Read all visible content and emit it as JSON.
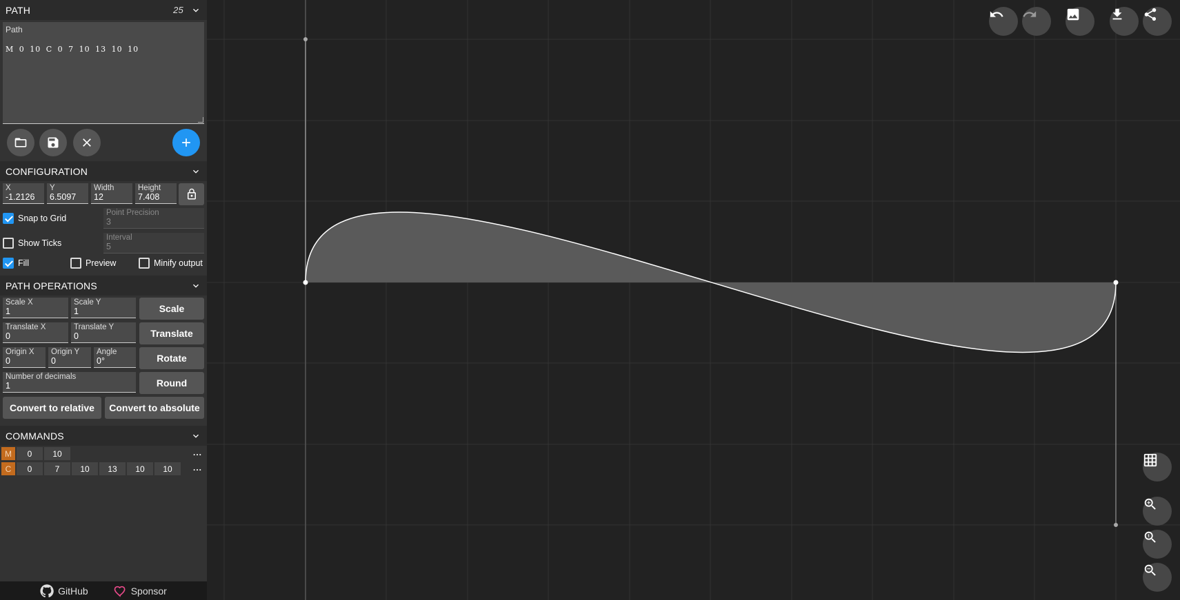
{
  "path_panel": {
    "header": "PATH",
    "count": "25",
    "textarea_label": "Path",
    "textarea_value": "M 0 10 C 0 7 10 13 10 10"
  },
  "configuration": {
    "header": "CONFIGURATION",
    "x_label": "X",
    "x_value": "-1.2126",
    "y_label": "Y",
    "y_value": "6.5097",
    "width_label": "Width",
    "width_value": "12",
    "height_label": "Height",
    "height_value": "7.408",
    "snap_label": "Snap to Grid",
    "snap_checked": true,
    "precision_label": "Point Precision",
    "precision_value": "3",
    "ticks_label": "Show Ticks",
    "ticks_checked": false,
    "interval_label": "Interval",
    "interval_value": "5",
    "fill_label": "Fill",
    "fill_checked": true,
    "preview_label": "Preview",
    "preview_checked": false,
    "minify_label": "Minify output",
    "minify_checked": false
  },
  "operations": {
    "header": "PATH OPERATIONS",
    "scale_x_label": "Scale X",
    "scale_x_value": "1",
    "scale_y_label": "Scale Y",
    "scale_y_value": "1",
    "scale_button": "Scale",
    "translate_x_label": "Translate X",
    "translate_x_value": "0",
    "translate_y_label": "Translate Y",
    "translate_y_value": "0",
    "translate_button": "Translate",
    "origin_x_label": "Origin X",
    "origin_x_value": "0",
    "origin_y_label": "Origin Y",
    "origin_y_value": "0",
    "angle_label": "Angle",
    "angle_value": "0°",
    "rotate_button": "Rotate",
    "decimals_label": "Number of decimals",
    "decimals_value": "1",
    "round_button": "Round",
    "relative_button": "Convert to relative",
    "absolute_button": "Convert to absolute"
  },
  "commands": {
    "header": "COMMANDS",
    "rows": [
      {
        "letter": "M",
        "values": [
          "0",
          "10"
        ]
      },
      {
        "letter": "C",
        "values": [
          "0",
          "7",
          "10",
          "13",
          "10",
          "10"
        ]
      }
    ],
    "more": "..."
  },
  "footer": {
    "github": "GitHub",
    "sponsor": "Sponsor"
  },
  "icons": {
    "open": "folder-icon",
    "save": "save-icon",
    "clear": "close-icon",
    "add": "plus-icon",
    "lock": "lock-open-icon",
    "undo": "undo-icon",
    "redo": "redo-icon",
    "image": "image-icon",
    "download": "download-icon",
    "share": "share-icon",
    "grid": "grid-icon",
    "zoom_in": "zoom-in-icon",
    "zoom_fit": "zoom-reset-icon",
    "zoom_out": "zoom-out-icon",
    "collapse": "chevron-left-icon"
  },
  "colors": {
    "accent": "#2196f3",
    "command": "#c36b1e",
    "fill": "#5a5a5a",
    "background": "#222222"
  }
}
